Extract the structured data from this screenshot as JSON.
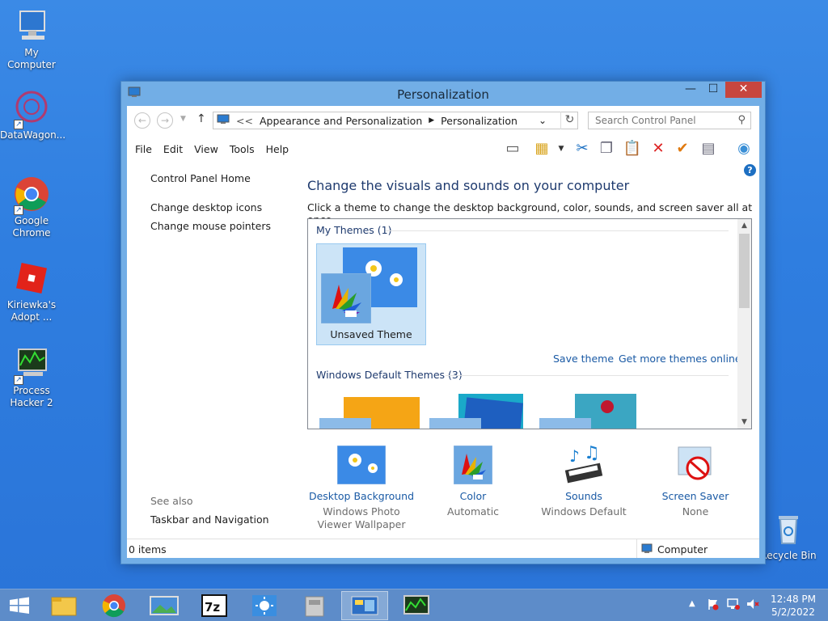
{
  "desktop": {
    "icons": [
      {
        "label": "My Computer"
      },
      {
        "label": "DataWagon..."
      },
      {
        "label": "Google Chrome"
      },
      {
        "label": "Kiriewka's Adopt ..."
      },
      {
        "label": "Process Hacker 2"
      },
      {
        "label": "Recycle Bin"
      }
    ]
  },
  "window": {
    "title": "Personalization",
    "address": {
      "chevron": "<<",
      "crumbs": [
        "Appearance and Personalization",
        "Personalization"
      ]
    },
    "search_placeholder": "Search Control Panel",
    "menu": [
      "File",
      "Edit",
      "View",
      "Tools",
      "Help"
    ],
    "sidebar": {
      "home": "Control Panel Home",
      "links": [
        "Change desktop icons",
        "Change mouse pointers"
      ],
      "see_also": "See also",
      "see_also_links": [
        "Taskbar and Navigation"
      ]
    },
    "heading": "Change the visuals and sounds on your computer",
    "subtitle": "Click a theme to change the desktop background, color, sounds, and screen saver all at once.",
    "my_themes": {
      "title": "My Themes (1)",
      "selected_theme": "Unsaved Theme",
      "save_link": "Save theme",
      "more_link": "Get more themes online"
    },
    "default_themes": {
      "title": "Windows Default Themes (3)"
    },
    "bottom": [
      {
        "title": "Desktop Background",
        "sub": "Windows Photo Viewer Wallpaper"
      },
      {
        "title": "Color",
        "sub": "Automatic"
      },
      {
        "title": "Sounds",
        "sub": "Windows Default"
      },
      {
        "title": "Screen Saver",
        "sub": "None"
      }
    ],
    "status": {
      "items": "0 items",
      "location": "Computer"
    }
  },
  "taskbar": {
    "time": "12:48 PM",
    "date": "5/2/2022"
  },
  "colors": {
    "link": "#1a5aa5",
    "titlebar": "#72aee6",
    "close": "#c7463f",
    "selection": "#cce4f7"
  }
}
